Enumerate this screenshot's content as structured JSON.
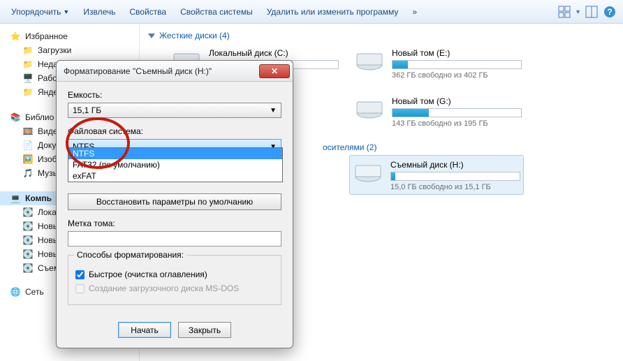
{
  "toolbar": {
    "organize": "Упорядочить",
    "extract": "Извлечь",
    "properties": "Свойства",
    "system_properties": "Свойства системы",
    "uninstall": "Удалить или изменить программу",
    "more": "»"
  },
  "sidebar": {
    "favorites": "Избранное",
    "downloads": "Загрузки",
    "recent": "Недав",
    "desktop": "Рабоч",
    "yandex": "Яндек",
    "libraries": "Библио",
    "video": "Видео",
    "documents": "Докум",
    "pictures": "Изобр",
    "music": "Музы",
    "computer": "Компь",
    "local": "Локал",
    "newvol1": "Новы",
    "newvol2": "Новы",
    "newvol3": "Новы",
    "removable": "Съем",
    "network": "Сеть"
  },
  "content": {
    "hard_disks_header": "Жесткие диски (4)",
    "drives": {
      "c": {
        "label": "Локальный диск (C:)",
        "fill": 0
      },
      "e": {
        "label": "Новый том (E:)",
        "free": "362 ГБ свободно из 402 ГБ",
        "fill": 12
      },
      "g": {
        "label": "Новый том (G:)",
        "free": "143 ГБ свободно из 195 ГБ",
        "fill": 28
      }
    },
    "removable_header": "осителями (2)",
    "removable": {
      "h": {
        "label": "Съемный диск (H:)",
        "free": "15,0 ГБ свободно из 15,1 ГБ",
        "fill": 3
      }
    }
  },
  "dialog": {
    "title": "Форматирование \"Съемный диск (H:)\"",
    "capacity_label": "Емкость:",
    "capacity_value": "15,1 ГБ",
    "fs_label": "Файловая система:",
    "fs_value": "NTFS",
    "fs_options": {
      "ntfs": "NTFS",
      "fat32": "FAT32 (по умолчанию)",
      "exfat": "exFAT"
    },
    "restore_defaults": "Восстановить параметры по умолчанию",
    "volume_label": "Метка тома:",
    "group": "Способы форматирования:",
    "quick": "Быстрое (очистка оглавления)",
    "msdos": "Создание загрузочного диска MS-DOS",
    "start": "Начать",
    "close": "Закрыть"
  }
}
